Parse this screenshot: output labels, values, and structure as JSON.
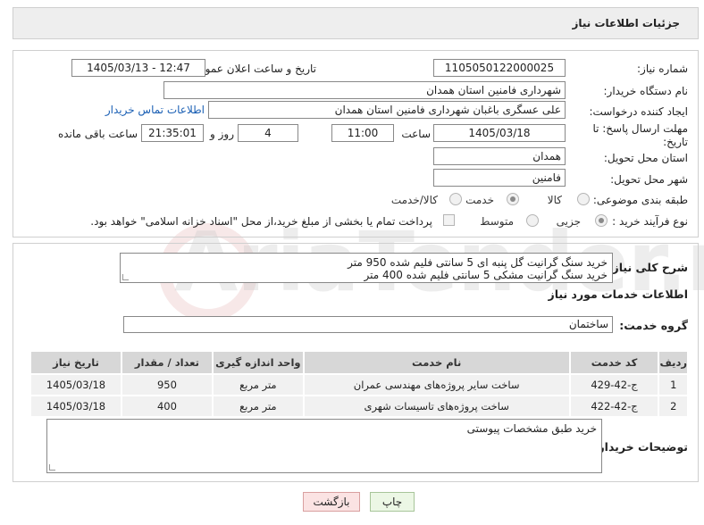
{
  "header": {
    "title": "جزئیات اطلاعات نیاز"
  },
  "labels": {
    "need_number": "شماره نیاز:",
    "announce_datetime": "تاریخ و ساعت اعلان عمومی:",
    "buyer_org": "نام دستگاه خریدار:",
    "requester": "ایجاد کننده درخواست:",
    "deadline_line1": "مهلت ارسال پاسخ: تا",
    "deadline_line2": "تاریخ:",
    "time": "ساعت",
    "day_and": "روز و",
    "remaining_hours": "ساعت باقی مانده",
    "province": "استان محل تحویل:",
    "city": "شهر محل تحویل:",
    "category": "طبقه بندی موضوعی:",
    "process_type": "نوع فرآیند خرید :",
    "general_desc": "شرح کلی نیاز:",
    "services_info": "اطلاعات خدمات مورد نیاز",
    "service_group": "گروه خدمت:",
    "buyer_notes": "توضیحات خریدار:"
  },
  "values": {
    "need_number": "1105050122000025",
    "announce_datetime": "1405/03/13 - 12:47",
    "buyer_org": "شهرداری فامنین استان همدان",
    "requester": "علی عسگری باغبان شهرداری فامنین استان همدان",
    "contact_link": "اطلاعات تماس خریدار",
    "deadline_date": "1405/03/18",
    "deadline_time": "11:00",
    "days": "4",
    "remaining": "21:35:01",
    "province": "همدان",
    "city": "فامنین",
    "service_group": "ساختمان",
    "general_desc_line1": "خرید سنگ گرانیت  گل پنبه ای  5 سانتی فلیم شده 950 متر",
    "general_desc_line2": "خرید سنگ گرانیت مشکی 5 سانتی فلیم شده 400 متر",
    "buyer_notes": "خرید طبق مشخصات پیوستی"
  },
  "category_options": [
    {
      "label": "کالا",
      "selected": false
    },
    {
      "label": "خدمت",
      "selected": true
    },
    {
      "label": "کالا/خدمت",
      "selected": false
    }
  ],
  "process_options": [
    {
      "label": "جزیی",
      "selected": true
    },
    {
      "label": "متوسط",
      "selected": false
    }
  ],
  "payment_note": "پرداخت تمام یا بخشی از مبلغ خرید،از محل \"اسناد خزانه اسلامی\" خواهد بود.",
  "table": {
    "headers": [
      "ردیف",
      "کد خدمت",
      "نام خدمت",
      "واحد اندازه گیری",
      "تعداد / مقدار",
      "تاریخ نیاز"
    ],
    "rows": [
      [
        "1",
        "ج-42-429",
        "ساخت سایر پروژه‌های مهندسی عمران",
        "متر مربع",
        "950",
        "1405/03/18"
      ],
      [
        "2",
        "ج-42-422",
        "ساخت پروژه‌های تاسیسات شهری",
        "متر مربع",
        "400",
        "1405/03/18"
      ]
    ]
  },
  "buttons": {
    "print": "چاپ",
    "back": "بازگشت"
  },
  "watermark": "AriaTender.neT",
  "colors": {
    "link": "#1a5fb4",
    "header_bg": "#eeeeee",
    "table_header_bg": "#d7d7d7",
    "back_button_bg": "#fbe3e3",
    "print_button_bg": "#ecf7e5"
  }
}
